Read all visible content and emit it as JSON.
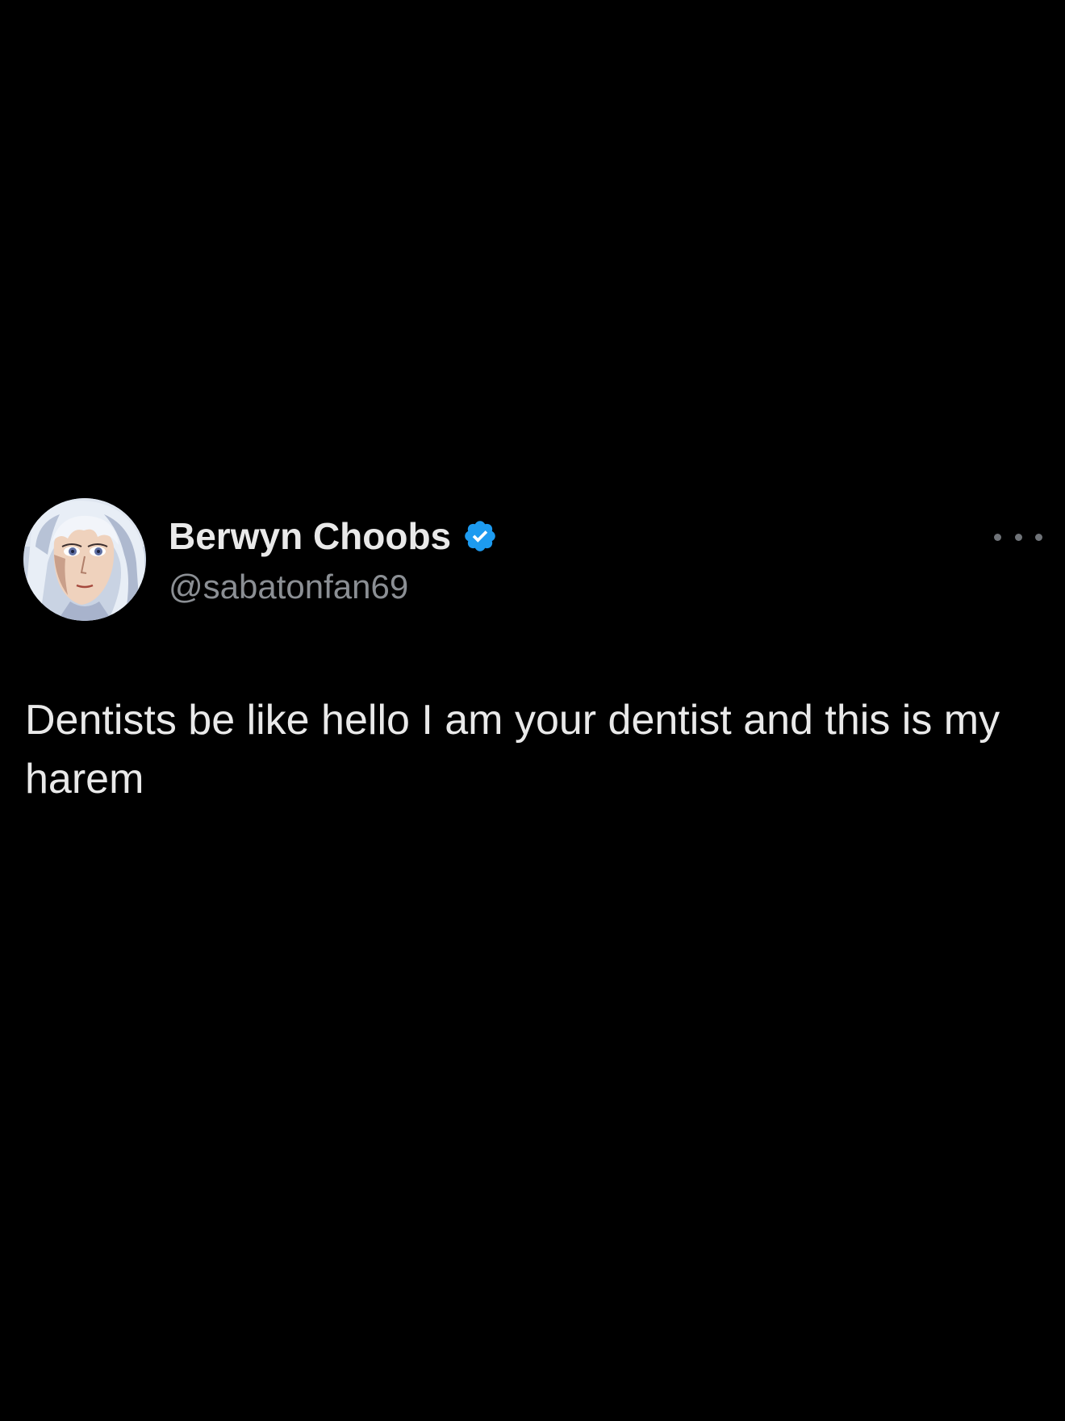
{
  "tweet": {
    "author": {
      "display_name": "Berwyn Choobs",
      "handle": "@sabatonfan69",
      "verified": true,
      "verified_color": "#1d9bf0",
      "avatar_icon": "anime-character-avatar"
    },
    "more_icon": "more-horizontal-icon",
    "text": "Dentists be like hello I am your dentist and this is my harem"
  },
  "colors": {
    "background": "#000000",
    "primary_text": "#e9e9e9",
    "secondary_text": "#8b8f94",
    "accent": "#1d9bf0"
  }
}
